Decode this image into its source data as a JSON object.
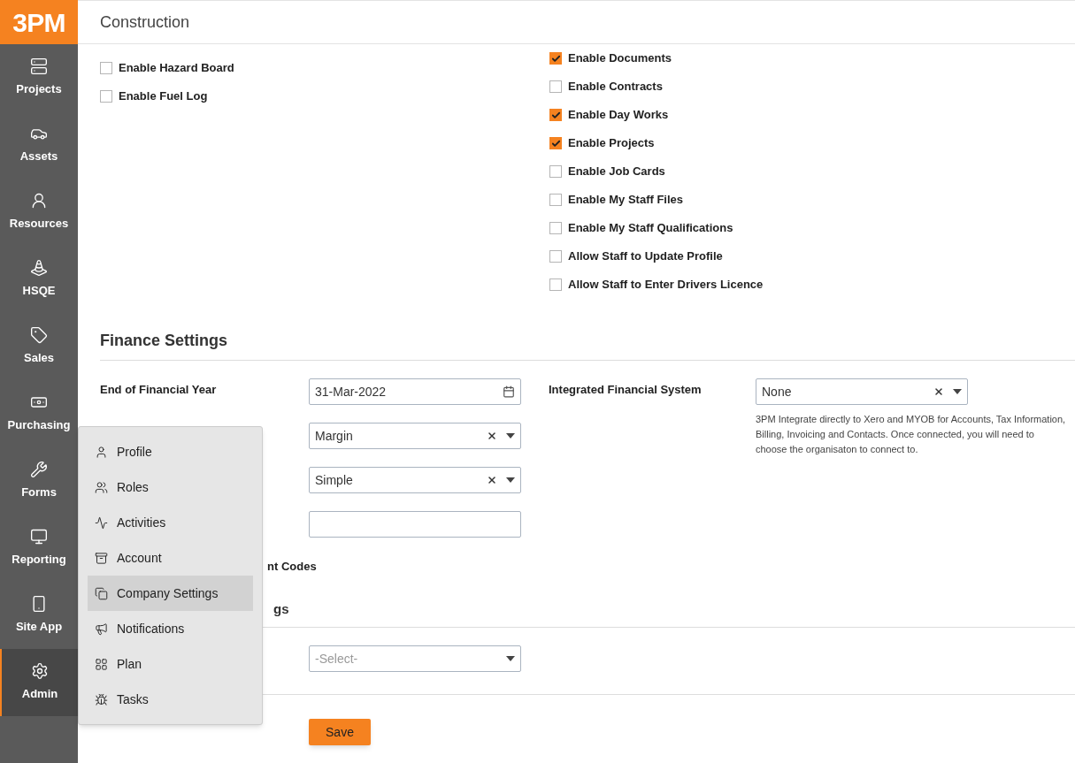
{
  "logo": "3PM",
  "sidebar": {
    "items": [
      {
        "label": "Projects",
        "selected": false
      },
      {
        "label": "Assets",
        "selected": false
      },
      {
        "label": "Resources",
        "selected": false
      },
      {
        "label": "HSQE",
        "selected": false
      },
      {
        "label": "Sales",
        "selected": false
      },
      {
        "label": "Purchasing",
        "selected": false
      },
      {
        "label": "Forms",
        "selected": false
      },
      {
        "label": "Reporting",
        "selected": false
      },
      {
        "label": "Site App",
        "selected": false
      },
      {
        "label": "Admin",
        "selected": true
      }
    ]
  },
  "header": {
    "title": "Construction"
  },
  "modules": {
    "left": [
      {
        "label": "Enable Hazard Board",
        "checked": false
      },
      {
        "label": "Enable Fuel Log",
        "checked": false
      }
    ],
    "right": [
      {
        "label": "Enable Documents",
        "checked": true
      },
      {
        "label": "Enable Contracts",
        "checked": false
      },
      {
        "label": "Enable Day Works",
        "checked": true
      },
      {
        "label": "Enable Projects",
        "checked": true
      },
      {
        "label": "Enable Job Cards",
        "checked": false
      },
      {
        "label": "Enable My Staff Files",
        "checked": false
      },
      {
        "label": "Enable My Staff Qualifications",
        "checked": false
      },
      {
        "label": "Allow Staff to Update Profile",
        "checked": false
      },
      {
        "label": "Allow Staff to Enter Drivers Licence",
        "checked": false
      }
    ]
  },
  "finance": {
    "heading": "Finance Settings",
    "rows": [
      {
        "kind": "date",
        "label": "End of Financial Year",
        "value": "31-Mar-2022"
      },
      {
        "kind": "select",
        "value": "Margin"
      },
      {
        "kind": "select",
        "value": "Simple"
      },
      {
        "kind": "text"
      },
      {
        "kind": "label",
        "label": "nt Codes"
      }
    ],
    "integration": {
      "label": "Integrated Financial System",
      "value": "None",
      "help": "3PM Integrate directly to Xero and MYOB for Accounts, Tax Information, Billing, Invoicing and Contacts. Once connected, you will need to choose the organisaton to connect to."
    }
  },
  "second": {
    "heading": "gs",
    "select": {
      "placeholder": "-Select-"
    }
  },
  "save": "Save",
  "menu": {
    "items": [
      {
        "label": "Profile",
        "selected": false
      },
      {
        "label": "Roles",
        "selected": false
      },
      {
        "label": "Activities",
        "selected": false
      },
      {
        "label": "Account",
        "selected": false
      },
      {
        "label": "Company Settings",
        "selected": true
      },
      {
        "label": "Notifications",
        "selected": false
      },
      {
        "label": "Plan",
        "selected": false
      },
      {
        "label": "Tasks",
        "selected": false
      }
    ]
  }
}
